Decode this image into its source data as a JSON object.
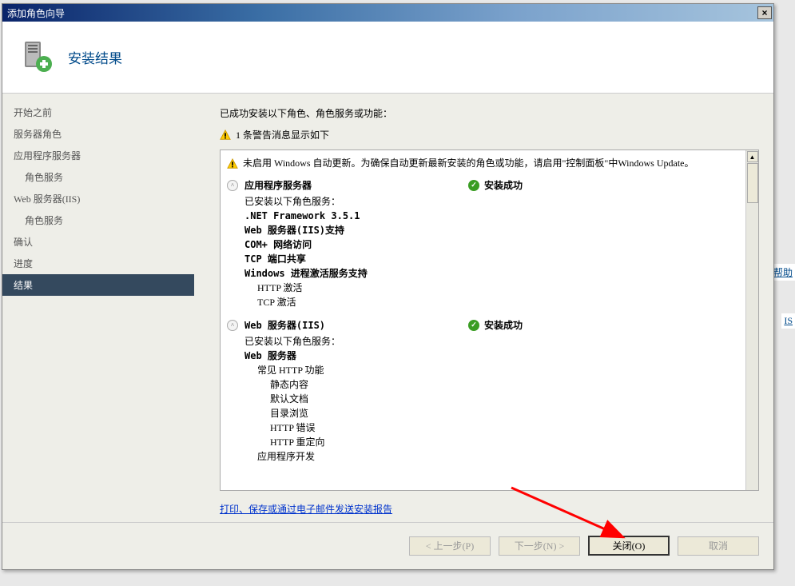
{
  "titlebar": {
    "title": "添加角色向导",
    "close": "×"
  },
  "header": {
    "title": "安装结果"
  },
  "sidebar": {
    "items": [
      {
        "label": "开始之前",
        "indent": false
      },
      {
        "label": "服务器角色",
        "indent": false
      },
      {
        "label": "应用程序服务器",
        "indent": false
      },
      {
        "label": "角色服务",
        "indent": true
      },
      {
        "label": "Web 服务器(IIS)",
        "indent": false
      },
      {
        "label": "角色服务",
        "indent": true
      },
      {
        "label": "确认",
        "indent": false
      },
      {
        "label": "进度",
        "indent": false
      },
      {
        "label": "结果",
        "indent": false,
        "selected": true
      }
    ]
  },
  "main": {
    "intro": "已成功安装以下角色、角色服务或功能：",
    "warn_summary": "1 条警告消息显示如下",
    "box_warning": "未启用 Windows 自动更新。为确保自动更新最新安装的角色或功能，请启用\"控制面板\"中Windows Update。",
    "sections": [
      {
        "title": "应用程序服务器",
        "status": "安装成功",
        "body_intro": "已安装以下角色服务：",
        "items": [
          {
            "text": ".NET Framework 3.5.1",
            "bold": true,
            "lv": 0
          },
          {
            "text": "Web 服务器(IIS)支持",
            "bold": true,
            "lv": 0
          },
          {
            "text": "COM+ 网络访问",
            "bold": true,
            "lv": 0
          },
          {
            "text": "TCP 端口共享",
            "bold": true,
            "lv": 0
          },
          {
            "text": "Windows 进程激活服务支持",
            "bold": true,
            "lv": 0
          },
          {
            "text": "HTTP 激活",
            "bold": false,
            "lv": 1
          },
          {
            "text": "TCP 激活",
            "bold": false,
            "lv": 1
          }
        ]
      },
      {
        "title": "Web 服务器(IIS)",
        "status": "安装成功",
        "body_intro": "已安装以下角色服务：",
        "items": [
          {
            "text": "Web 服务器",
            "bold": true,
            "lv": 0
          },
          {
            "text": "常见 HTTP 功能",
            "bold": false,
            "lv": 1
          },
          {
            "text": "静态内容",
            "bold": false,
            "lv": 2
          },
          {
            "text": "默认文档",
            "bold": false,
            "lv": 2
          },
          {
            "text": "目录浏览",
            "bold": false,
            "lv": 2
          },
          {
            "text": "HTTP 错误",
            "bold": false,
            "lv": 2
          },
          {
            "text": "HTTP 重定向",
            "bold": false,
            "lv": 2
          },
          {
            "text": "应用程序开发",
            "bold": false,
            "lv": 1
          }
        ]
      }
    ],
    "report_link": "打印、保存或通过电子邮件发送安装报告"
  },
  "buttons": {
    "previous": "< 上一步(P)",
    "next": "下一步(N) >",
    "close": "关闭(O)",
    "cancel": "取消"
  },
  "bg_fragments": {
    "help": "帮助",
    "is": "IS"
  }
}
